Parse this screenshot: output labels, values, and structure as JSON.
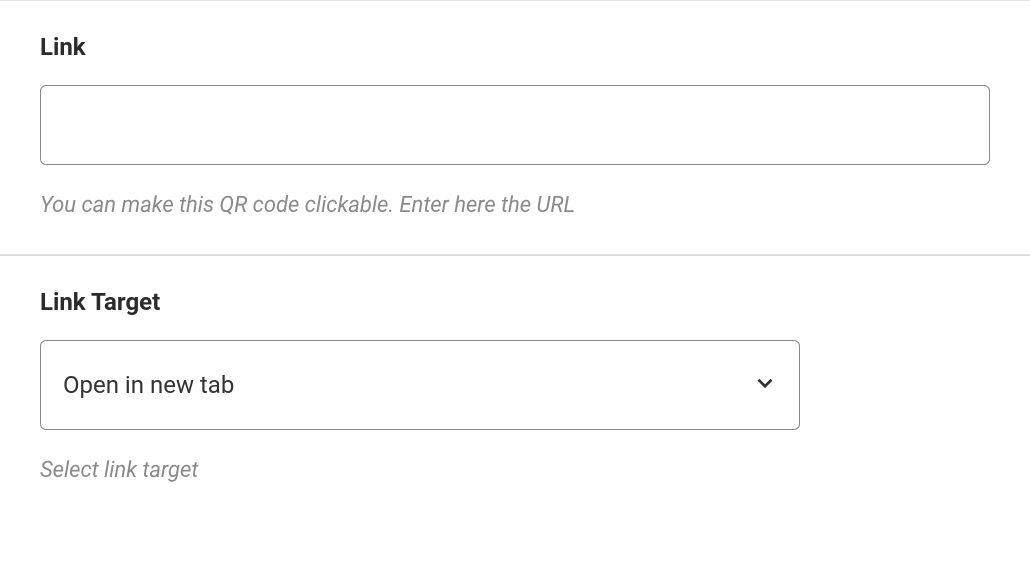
{
  "link_section": {
    "label": "Link",
    "value": "",
    "help": "You can make this QR code clickable. Enter here the URL"
  },
  "link_target_section": {
    "label": "Link Target",
    "selected": "Open in new tab",
    "help": "Select link target"
  }
}
